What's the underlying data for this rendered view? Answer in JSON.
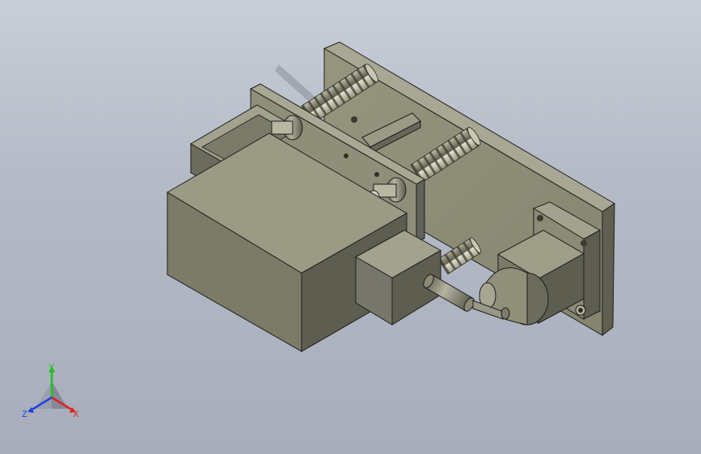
{
  "viewport": {
    "background_top": "#c9ced8",
    "background_bottom": "#a7adba"
  },
  "model": {
    "part_color": "#8a8a76",
    "part_dark": "#5f5f52",
    "part_light": "#a3a38f",
    "edge_color": "#1e1e1e"
  },
  "triad": {
    "y_label": "Y",
    "x_label": "X",
    "z_label": "Z",
    "x_color": "#e02020",
    "y_color": "#20c020",
    "z_color": "#2040e0"
  }
}
